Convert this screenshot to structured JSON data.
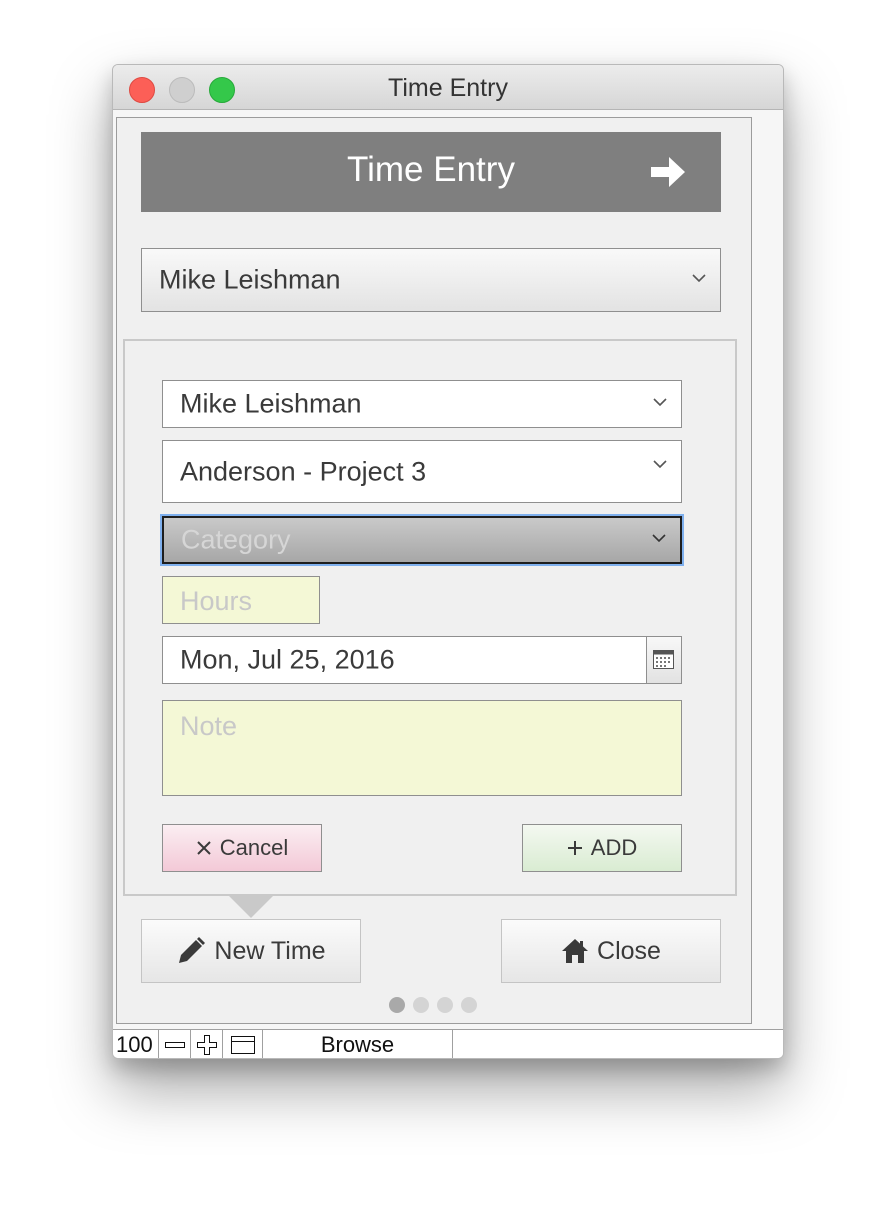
{
  "window": {
    "title": "Time Entry"
  },
  "header": {
    "title": "Time Entry",
    "next_icon": "arrow-right-icon"
  },
  "top_select": {
    "value": "Mike Leishman"
  },
  "form": {
    "user": {
      "value": "Mike Leishman"
    },
    "project": {
      "value": "Anderson  -  Project 3"
    },
    "category": {
      "placeholder": "Category"
    },
    "hours": {
      "placeholder": "Hours"
    },
    "date": {
      "value": "Mon, Jul 25, 2016",
      "icon": "calendar-icon"
    },
    "note": {
      "placeholder": "Note"
    },
    "cancel_label": "Cancel",
    "add_label": "ADD"
  },
  "nav": {
    "new_time_label": "New Time",
    "close_label": "Close",
    "pages": 4,
    "active_page": 1
  },
  "statusbar": {
    "zoom": "100",
    "mode": "Browse"
  },
  "colors": {
    "header_bg": "#7f7f7f",
    "input_highlight": "#f4f8d6",
    "cancel_bg": "#f3c9d7",
    "add_bg": "#d9ecd2",
    "focus_ring": "#7fb0ee"
  }
}
